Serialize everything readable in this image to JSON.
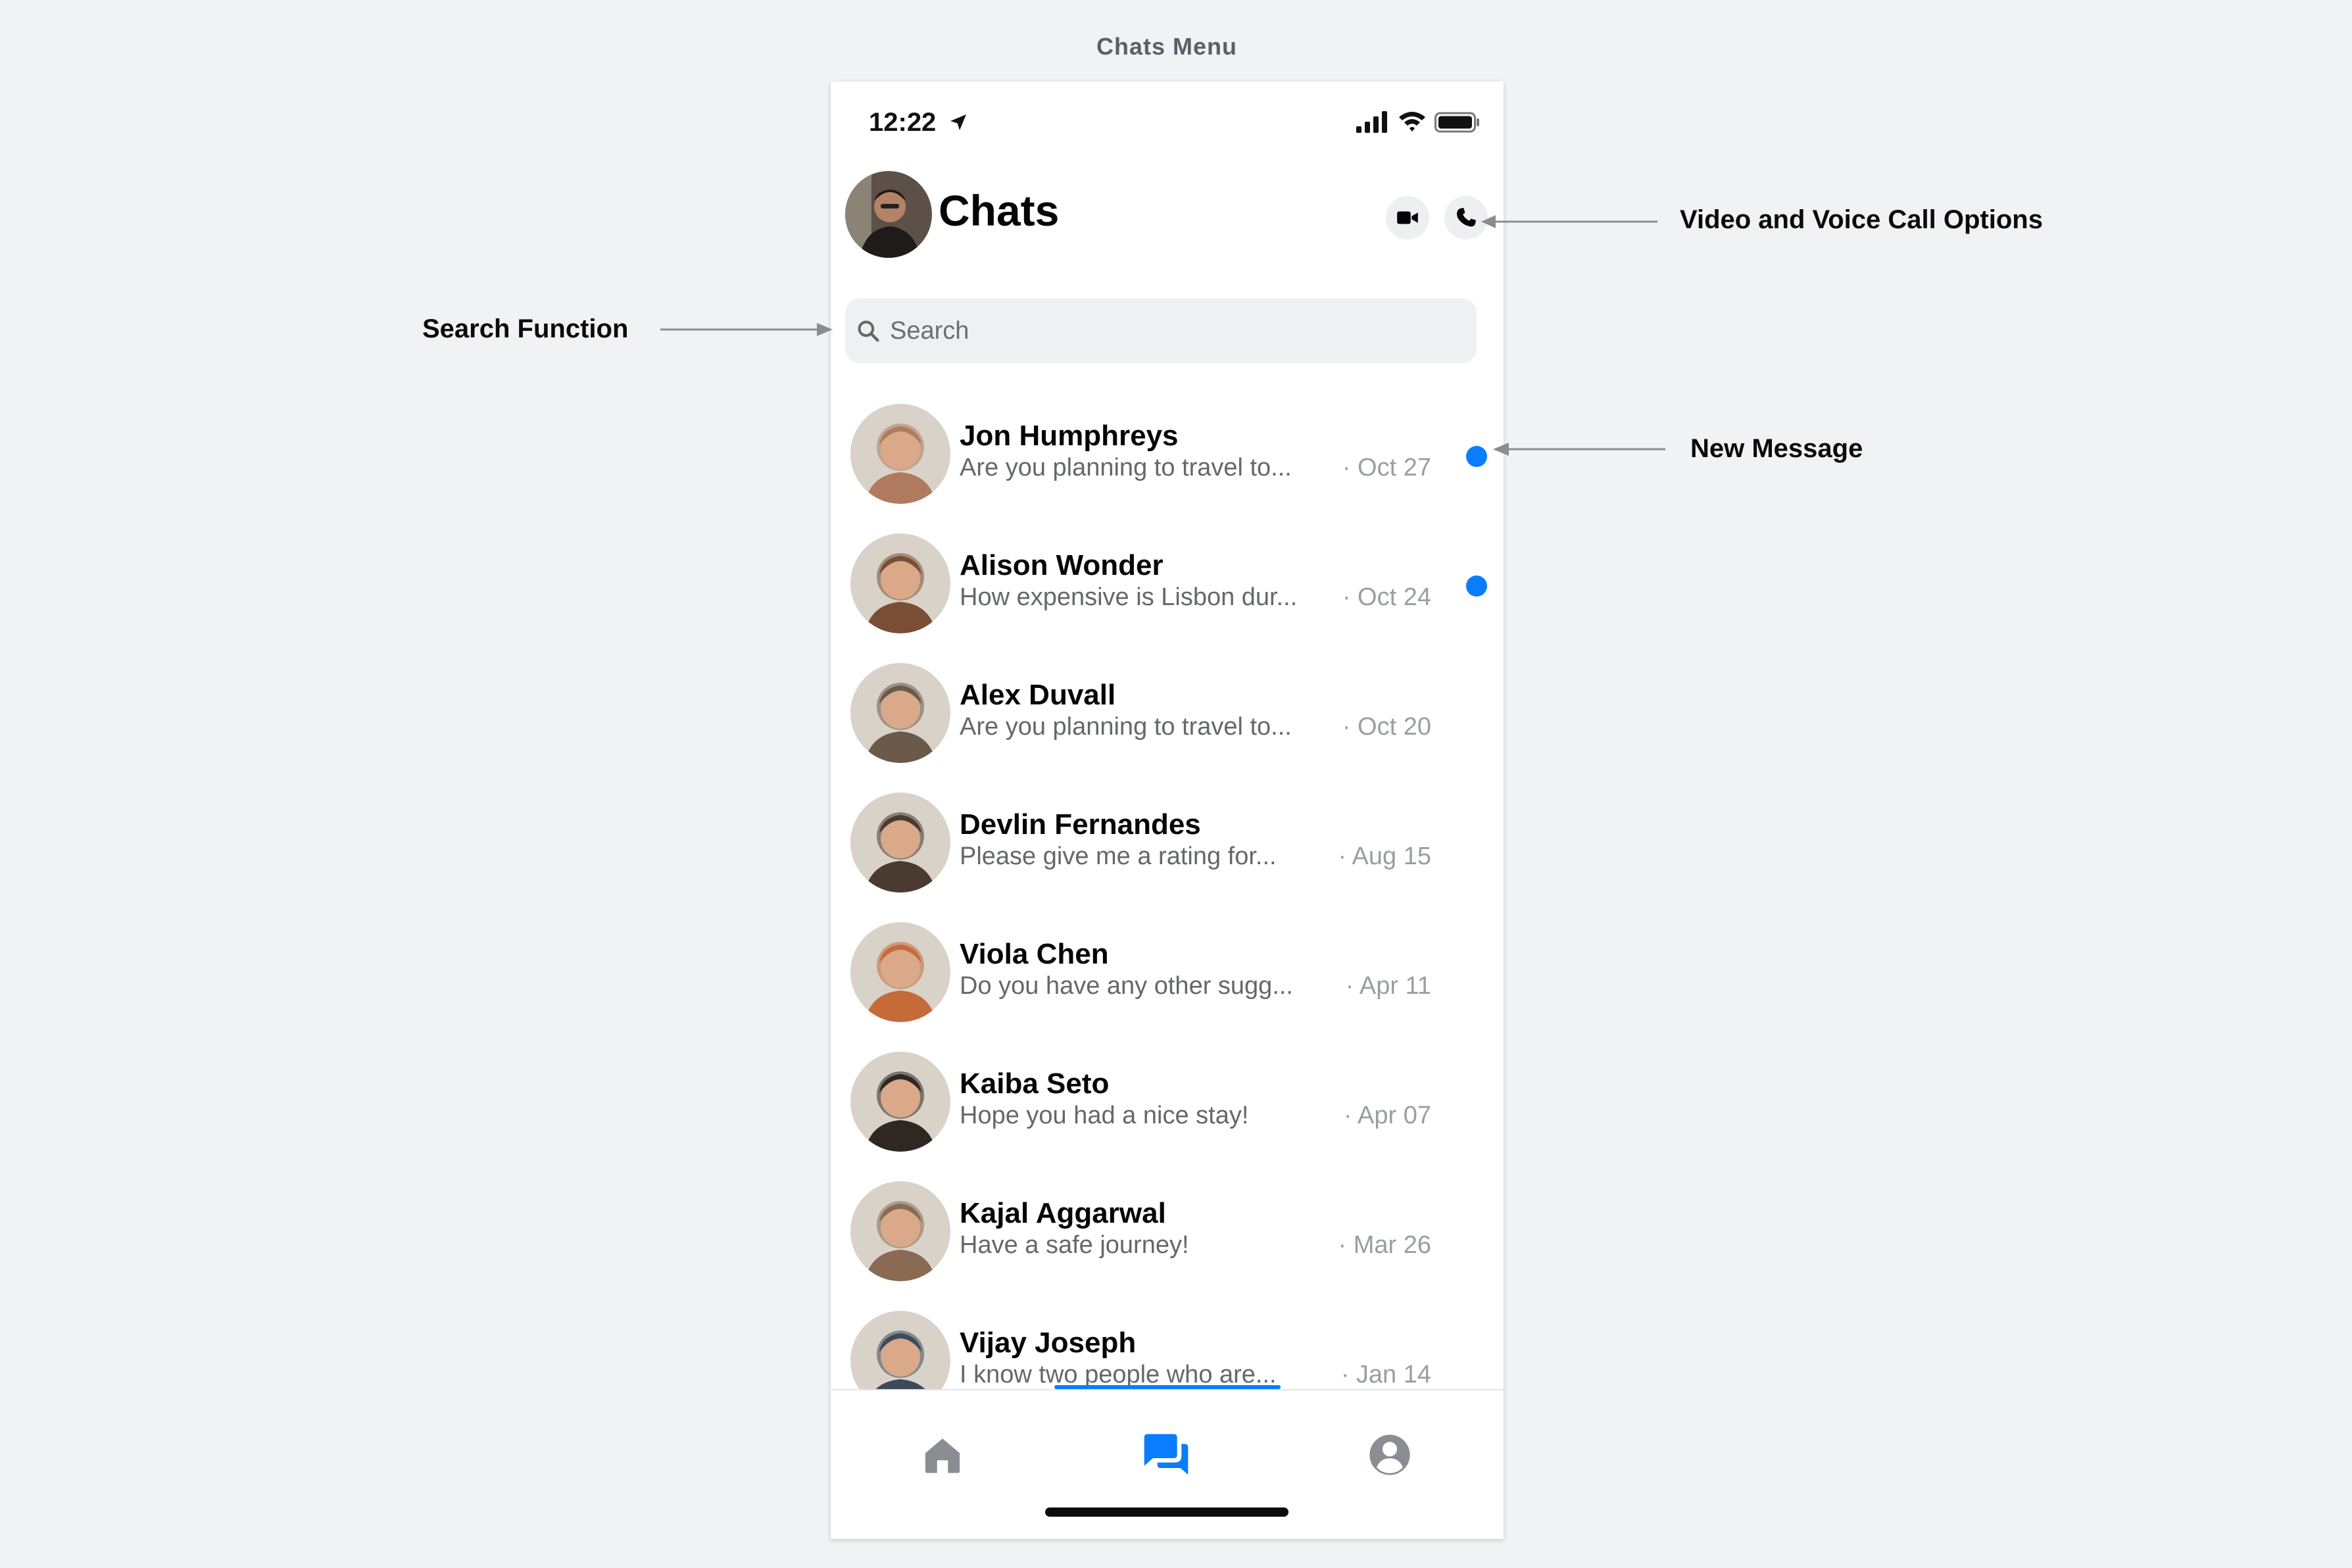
{
  "page": {
    "title": "Chats Menu"
  },
  "status_bar": {
    "time": "12:22"
  },
  "header": {
    "title": "Chats",
    "video_icon": "video-camera-icon",
    "phone_icon": "phone-icon"
  },
  "search": {
    "placeholder": "Search"
  },
  "chats": [
    {
      "name": "Jon Humphreys",
      "preview": "Are you planning to travel to...",
      "date": "· Oct 27",
      "unread": true,
      "avatar_color": "#b07a5e"
    },
    {
      "name": "Alison Wonder",
      "preview": "How expensive is Lisbon dur...",
      "date": "· Oct 24",
      "unread": true,
      "avatar_color": "#7a4e35"
    },
    {
      "name": "Alex Duvall",
      "preview": "Are you planning to travel to...",
      "date": "· Oct 20",
      "unread": false,
      "avatar_color": "#6b5a4a"
    },
    {
      "name": "Devlin Fernandes",
      "preview": "Please give me a rating for...",
      "date": "· Aug 15",
      "unread": false,
      "avatar_color": "#4a3a30"
    },
    {
      "name": "Viola Chen",
      "preview": "Do you have any other sugg...",
      "date": "· Apr 11",
      "unread": false,
      "avatar_color": "#c66a3a"
    },
    {
      "name": "Kaiba Seto",
      "preview": "Hope you had a nice stay!",
      "date": "· Apr 07",
      "unread": false,
      "avatar_color": "#2f2722"
    },
    {
      "name": "Kajal Aggarwal",
      "preview": "Have a safe journey!",
      "date": "· Mar 26",
      "unread": false,
      "avatar_color": "#8a6a52"
    },
    {
      "name": "Vijay Joseph",
      "preview": "I know two people who are...",
      "date": "· Jan 14",
      "unread": false,
      "avatar_color": "#3d4a5a"
    }
  ],
  "tabs": [
    {
      "name": "home",
      "icon": "home-icon"
    },
    {
      "name": "chats",
      "icon": "chat-bubbles-icon",
      "active": true
    },
    {
      "name": "profile",
      "icon": "profile-icon"
    }
  ],
  "annotations": {
    "video_voice": "Video and Voice Call Options",
    "search": "Search Function",
    "new_message": "New Message"
  },
  "colors": {
    "accent": "#0a7cff",
    "background": "#f1f2f4",
    "inactive_icon": "#8a8d91"
  }
}
